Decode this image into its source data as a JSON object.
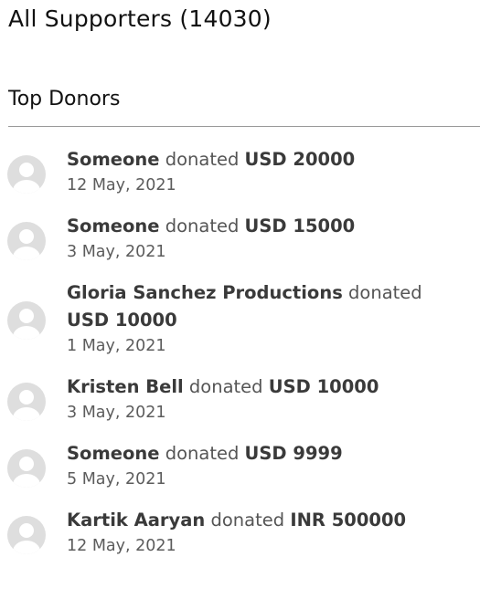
{
  "header": {
    "title": "All Supporters (14030)"
  },
  "section": {
    "title": "Top Donors"
  },
  "donors": [
    {
      "name": "Someone",
      "verb": "donated",
      "amount": "USD 20000",
      "date": "12 May, 2021",
      "icon": "user-avatar-icon"
    },
    {
      "name": "Someone",
      "verb": "donated",
      "amount": "USD 15000",
      "date": "3 May, 2021",
      "icon": "user-avatar-icon"
    },
    {
      "name": "Gloria Sanchez Productions",
      "verb": "donated",
      "amount": "USD 10000",
      "date": "1 May, 2021",
      "icon": "user-avatar-icon"
    },
    {
      "name": "Kristen Bell",
      "verb": "donated",
      "amount": "USD 10000",
      "date": "3 May, 2021",
      "icon": "user-avatar-icon"
    },
    {
      "name": "Someone",
      "verb": "donated",
      "amount": "USD 9999",
      "date": "5 May, 2021",
      "icon": "user-avatar-icon"
    },
    {
      "name": "Kartik Aaryan",
      "verb": "donated",
      "amount": "INR 500000",
      "date": "12 May, 2021",
      "icon": "user-avatar-icon"
    }
  ],
  "colors": {
    "avatar_bg": "#dedede",
    "avatar_fg": "#ffffff",
    "divider": "#9a9a9a"
  }
}
